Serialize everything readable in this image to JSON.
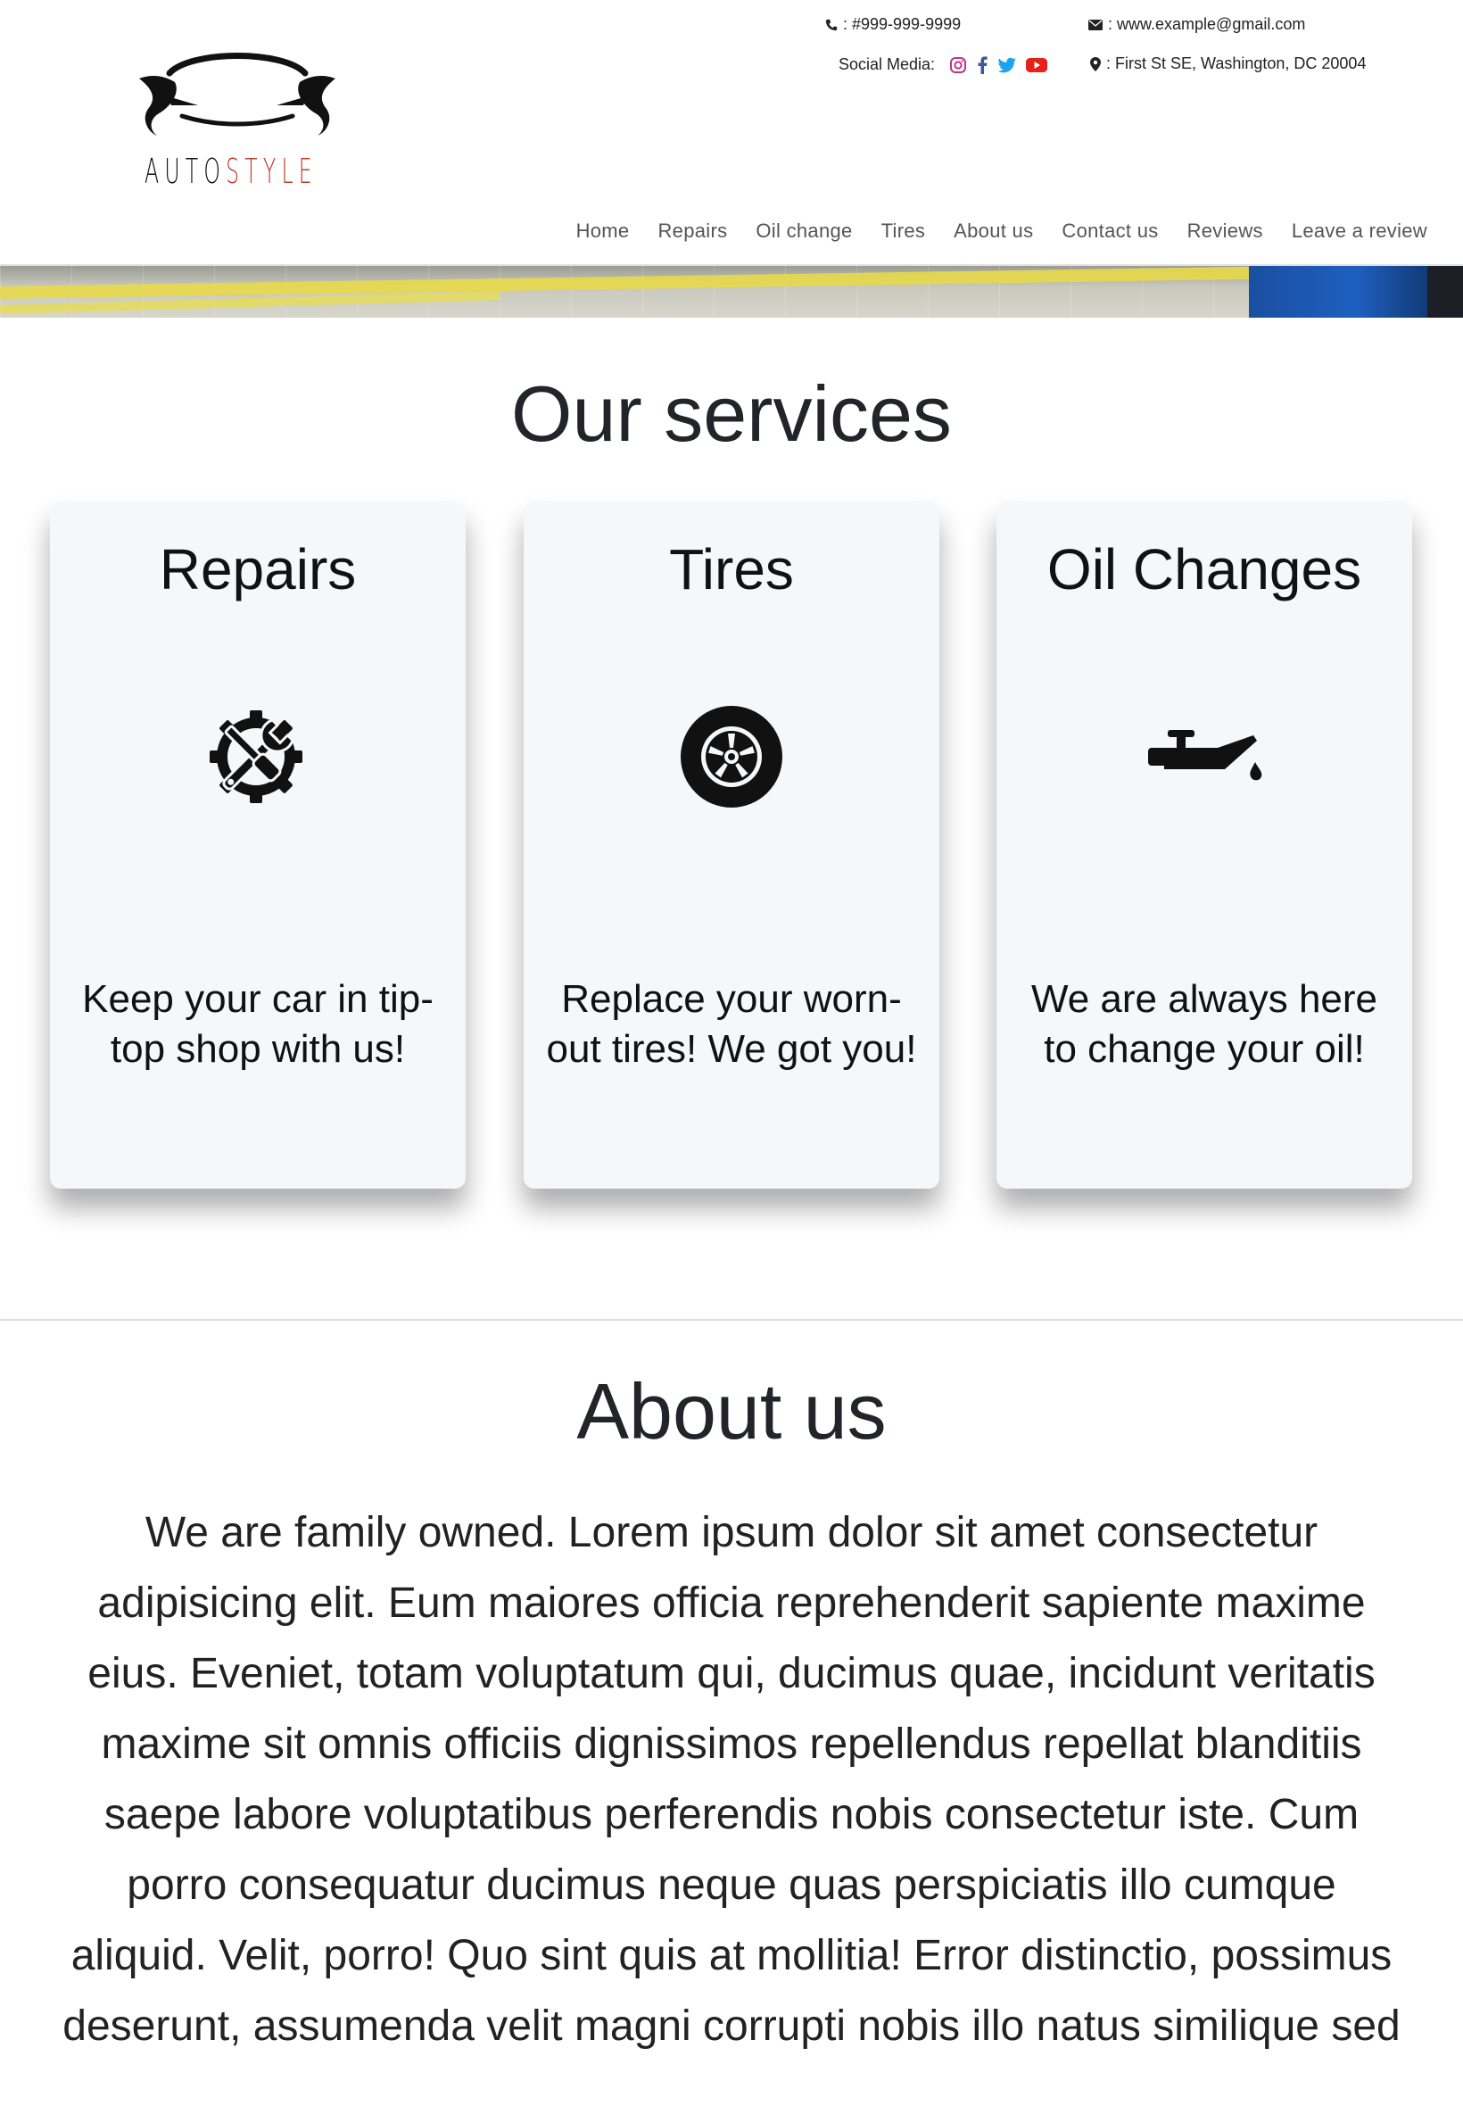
{
  "brand": {
    "name_part1": "AUTO",
    "name_part2": "STYLE"
  },
  "contact": {
    "phone": ": #999-999-9999",
    "email": ": www.example@gmail.com",
    "social_label": "Social Media:",
    "address": ": First St SE, Washington, DC 20004"
  },
  "nav": {
    "items": [
      "Home",
      "Repairs",
      "Oil change",
      "Tires",
      "About us",
      "Contact us",
      "Reviews",
      "Leave a review"
    ]
  },
  "services": {
    "title": "Our services",
    "cards": [
      {
        "title": "Repairs",
        "text": "Keep your car in tip-top shop with us!",
        "icon": "gear-wrench-icon"
      },
      {
        "title": "Tires",
        "text": "Replace your worn-out tires! We got you!",
        "icon": "tire-icon"
      },
      {
        "title": "Oil Changes",
        "text": "We are always here to change your oil!",
        "icon": "oil-can-icon"
      }
    ]
  },
  "about": {
    "title": "About us",
    "text": "We are family owned. Lorem ipsum dolor sit amet consectetur adipisicing elit. Eum maiores officia reprehenderit sapiente maxime eius. Eveniet, totam voluptatum qui, ducimus quae, incidunt veritatis maxime sit omnis officiis dignissimos repellendus repellat blanditiis saepe labore voluptatibus perferendis nobis consectetur iste. Cum porro consequatur ducimus neque quas perspiciatis illo cumque aliquid. Velit, porro! Quo sint quis at mollitia! Error distinctio, possimus deserunt, assumenda velit magni corrupti nobis illo natus similique sed"
  },
  "colors": {
    "accent_red": "#c0392b",
    "instagram": "#c13584",
    "facebook": "#3b5998",
    "twitter": "#1da1f2",
    "youtube": "#e62117"
  }
}
